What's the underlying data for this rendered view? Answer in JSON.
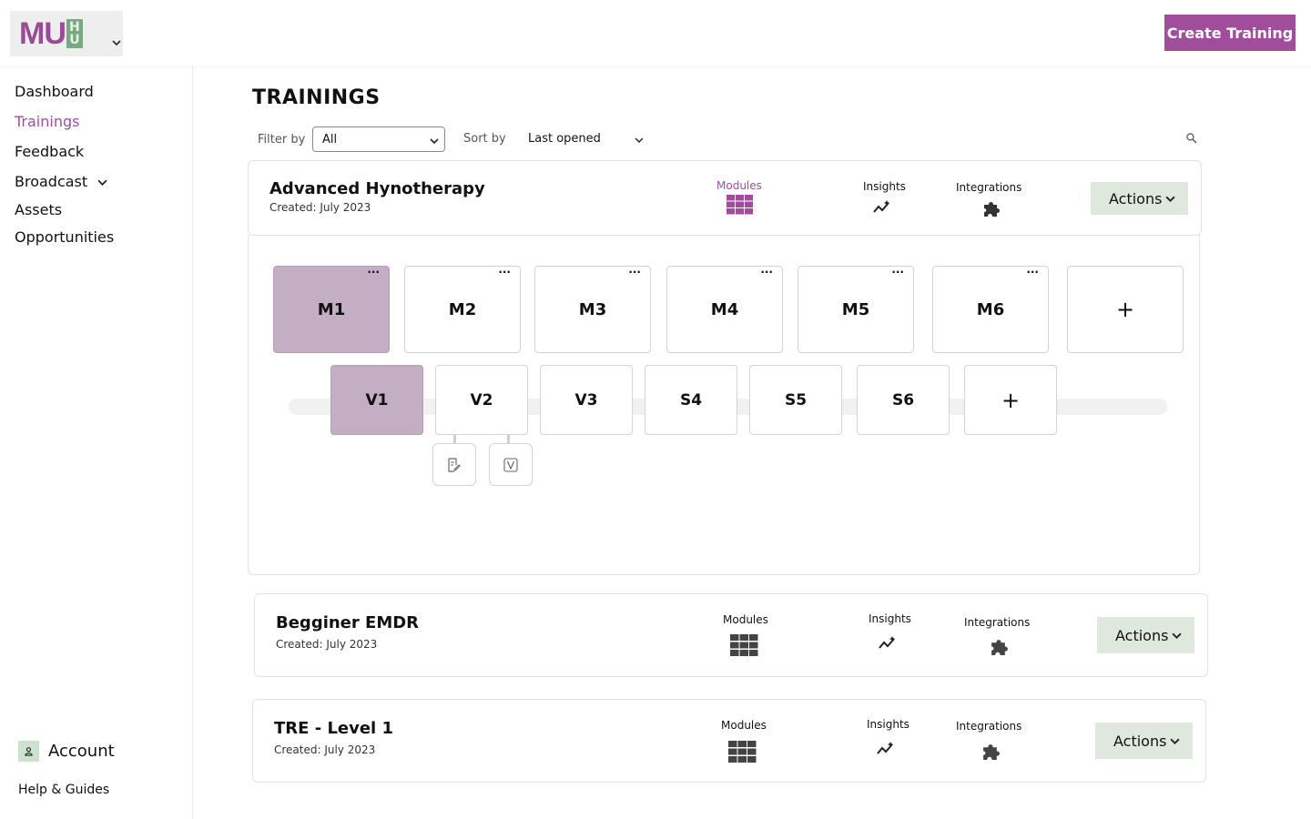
{
  "header": {
    "logo_text_main": "MU",
    "logo_text_h": "H",
    "logo_text_u": "U",
    "create_button": "Create Training"
  },
  "sidebar": {
    "items": [
      {
        "label": "Dashboard",
        "active": false
      },
      {
        "label": "Trainings",
        "active": true
      },
      {
        "label": "Feedback",
        "active": false
      },
      {
        "label": "Broadcast",
        "active": false,
        "has_dropdown": true
      },
      {
        "label": "Assets",
        "active": false
      },
      {
        "label": "Opportunities",
        "active": false
      }
    ],
    "account_label": "Account",
    "help_label": "Help & Guides"
  },
  "main": {
    "title": "TRAININGS",
    "filter": {
      "label": "Filter by",
      "value": "All"
    },
    "sort": {
      "label": "Sort by",
      "value": "Last opened"
    }
  },
  "trainings": [
    {
      "title": "Advanced Hynotherapy",
      "created": "Created: July 2023",
      "modules_label": "Modules",
      "insights_label": "Insights",
      "integrations_label": "Integrations",
      "actions_label": "Actions",
      "expanded": true
    },
    {
      "title": "Begginer EMDR",
      "created": "Created: July 2023",
      "modules_label": "Modules",
      "insights_label": "Insights",
      "integrations_label": "Integrations",
      "actions_label": "Actions",
      "expanded": false
    },
    {
      "title": "TRE - Level 1",
      "created": "Created: July 2023",
      "modules_label": "Modules",
      "insights_label": "Insights",
      "integrations_label": "Integrations",
      "actions_label": "Actions",
      "expanded": false
    }
  ],
  "modules": [
    {
      "label": "M1",
      "selected": true
    },
    {
      "label": "M2",
      "selected": false
    },
    {
      "label": "M3",
      "selected": false
    },
    {
      "label": "M4",
      "selected": false
    },
    {
      "label": "M5",
      "selected": false
    },
    {
      "label": "M6",
      "selected": false
    }
  ],
  "module_add": "+",
  "module_menu": "···",
  "sections": [
    {
      "label": "V1",
      "selected": true
    },
    {
      "label": "V2",
      "selected": false
    },
    {
      "label": "V3",
      "selected": false
    },
    {
      "label": "S4",
      "selected": false
    },
    {
      "label": "S5",
      "selected": false
    },
    {
      "label": "S6",
      "selected": false
    }
  ],
  "section_add": "+",
  "assets": [
    {
      "icon": "document-edit-icon"
    },
    {
      "icon": "video-icon"
    }
  ],
  "colors": {
    "brand": "#a04e9c",
    "selected_tile": "#c3aec3",
    "actions_bg": "#dfe8dc",
    "logo_green": "#7aa882"
  }
}
